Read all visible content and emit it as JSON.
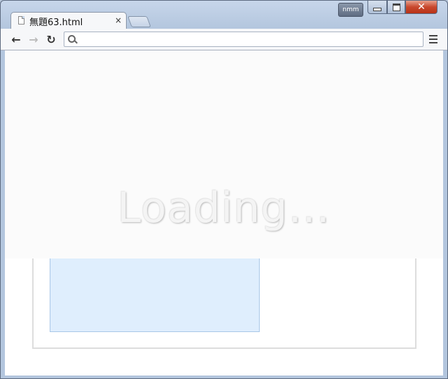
{
  "window": {
    "user_badge": "nmm",
    "controls": {
      "minimize_icon": "minimize-icon",
      "maximize_icon": "maximize-icon",
      "close_label": "✕"
    }
  },
  "tabs": [
    {
      "title": "無題63.html",
      "close_label": "×",
      "icon": "document-icon",
      "active": true
    }
  ],
  "toolbar": {
    "back_label": "←",
    "forward_label": "→",
    "reload_label": "↻",
    "address_value": "",
    "menu_icon": "hamburger-menu-icon"
  },
  "page": {
    "loading_text": "Loading…",
    "colors": {
      "overlay": "#fbfbfb",
      "blue_panel": "#dfeefd",
      "blue_panel_border": "#a9c7e8",
      "frame_border": "#dddddd"
    }
  }
}
